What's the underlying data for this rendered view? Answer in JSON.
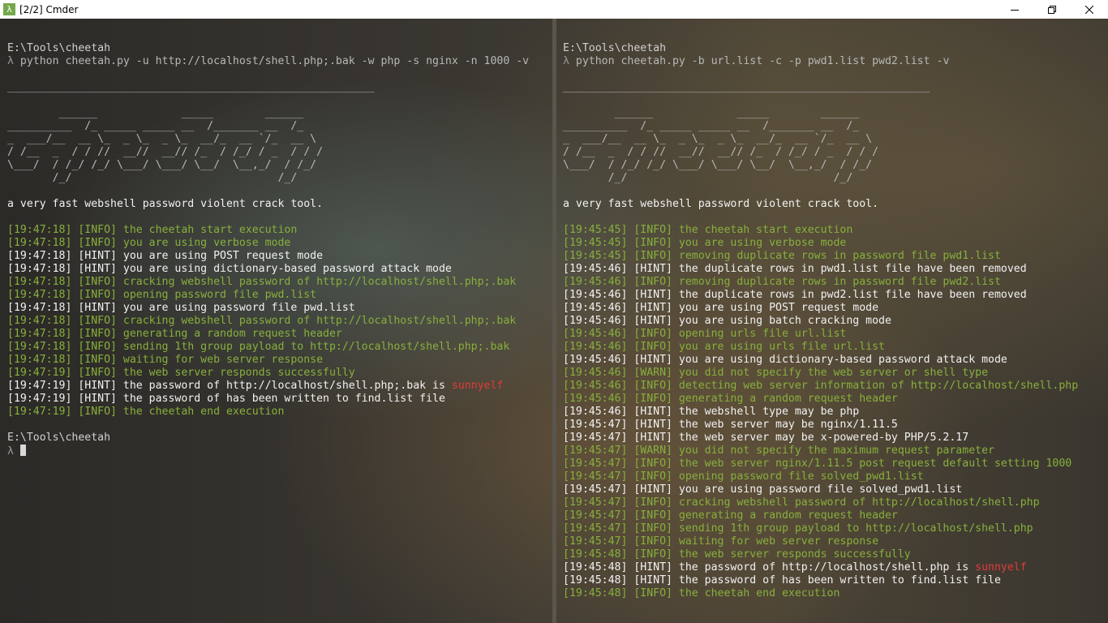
{
  "window": {
    "title": "[2/2] Cmder",
    "app_icon": "λ"
  },
  "colors": {
    "info": "#87b03c",
    "hint": "#f2f2f2",
    "password": "#e23a3a"
  },
  "left_pane": {
    "lines": [
      {
        "segs": [
          {
            "t": "E:\\Tools\\cheetah",
            "c": "prompt-path"
          }
        ]
      },
      {
        "segs": [
          {
            "t": "λ ",
            "c": "lambda"
          },
          {
            "t": "python cheetah.py -u http://localhost/shell.php;.bak -w php -s nginx -n 1000 -v",
            "c": "gray"
          }
        ]
      },
      {
        "segs": [
          {
            "t": "",
            "c": "gray"
          }
        ]
      },
      {
        "segs": [
          {
            "t": "_________________________________________________________",
            "c": "gray"
          }
        ]
      },
      {
        "segs": [
          {
            "t": "",
            "c": "gray"
          }
        ]
      },
      {
        "segs": [
          {
            "t": "        ______             _____        ______",
            "c": "gray"
          }
        ]
      },
      {
        "segs": [
          {
            "t": "__________  /_ _____ _____ __  /_______ __  /_",
            "c": "gray"
          }
        ]
      },
      {
        "segs": [
          {
            "t": "_  ___/__  __ \\_  _ \\_  _ \\_  __/_  __ `/_  __ \\",
            "c": "gray"
          }
        ]
      },
      {
        "segs": [
          {
            "t": "/ /__  _  / / //  __//  __// /_  / /_/ / _  / / /",
            "c": "gray"
          }
        ]
      },
      {
        "segs": [
          {
            "t": "\\___/  / /_/ /_/ \\___/ \\___/ \\__/  \\__,_/  / /_/",
            "c": "gray"
          }
        ]
      },
      {
        "segs": [
          {
            "t": "       /_/                                /_/",
            "c": "gray"
          }
        ]
      },
      {
        "segs": [
          {
            "t": "",
            "c": "gray"
          }
        ]
      },
      {
        "segs": [
          {
            "t": "a very fast webshell password violent crack tool.",
            "c": "white"
          }
        ]
      },
      {
        "segs": [
          {
            "t": "",
            "c": "gray"
          }
        ]
      },
      {
        "segs": [
          {
            "t": "[19:47:18] [INFO] the cheetah start execution",
            "c": "green"
          }
        ]
      },
      {
        "segs": [
          {
            "t": "[19:47:18] [INFO] you are using verbose mode",
            "c": "green"
          }
        ]
      },
      {
        "segs": [
          {
            "t": "[19:47:18] [HINT] you are using POST request mode",
            "c": "white"
          }
        ]
      },
      {
        "segs": [
          {
            "t": "[19:47:18] [HINT] you are using dictionary-based password attack mode",
            "c": "white"
          }
        ]
      },
      {
        "segs": [
          {
            "t": "[19:47:18] [INFO] cracking webshell password of http://localhost/shell.php;.bak",
            "c": "green"
          }
        ]
      },
      {
        "segs": [
          {
            "t": "[19:47:18] [INFO] opening password file pwd.list",
            "c": "green"
          }
        ]
      },
      {
        "segs": [
          {
            "t": "[19:47:18] [HINT] you are using password file pwd.list",
            "c": "white"
          }
        ]
      },
      {
        "segs": [
          {
            "t": "[19:47:18] [INFO] cracking webshell password of http://localhost/shell.php;.bak",
            "c": "green"
          }
        ]
      },
      {
        "segs": [
          {
            "t": "[19:47:18] [INFO] generating a random request header",
            "c": "green"
          }
        ]
      },
      {
        "segs": [
          {
            "t": "[19:47:18] [INFO] sending 1th group payload to http://localhost/shell.php;.bak",
            "c": "green"
          }
        ]
      },
      {
        "segs": [
          {
            "t": "[19:47:18] [INFO] waiting for web server response",
            "c": "green"
          }
        ]
      },
      {
        "segs": [
          {
            "t": "[19:47:19] [INFO] the web server responds successfully",
            "c": "green"
          }
        ]
      },
      {
        "segs": [
          {
            "t": "[19:47:19] [HINT] the password of http://localhost/shell.php;.bak is ",
            "c": "white"
          },
          {
            "t": "sunnyelf",
            "c": "red"
          }
        ]
      },
      {
        "segs": [
          {
            "t": "[19:47:19] [HINT] the password of has been written to find.list file",
            "c": "white"
          }
        ]
      },
      {
        "segs": [
          {
            "t": "[19:47:19] [INFO] the cheetah end execution",
            "c": "green"
          }
        ]
      },
      {
        "segs": [
          {
            "t": "",
            "c": "gray"
          }
        ]
      },
      {
        "segs": [
          {
            "t": "E:\\Tools\\cheetah",
            "c": "prompt-path"
          }
        ]
      },
      {
        "segs": [
          {
            "t": "λ ",
            "c": "lambda"
          }
        ],
        "cursor": true
      }
    ]
  },
  "right_pane": {
    "lines": [
      {
        "segs": [
          {
            "t": "E:\\Tools\\cheetah",
            "c": "prompt-path"
          }
        ]
      },
      {
        "segs": [
          {
            "t": "λ ",
            "c": "lambda"
          },
          {
            "t": "python cheetah.py -b url.list -c -p pwd1.list pwd2.list -v",
            "c": "gray"
          }
        ]
      },
      {
        "segs": [
          {
            "t": "",
            "c": "gray"
          }
        ]
      },
      {
        "segs": [
          {
            "t": "_________________________________________________________",
            "c": "gray"
          }
        ]
      },
      {
        "segs": [
          {
            "t": "",
            "c": "gray"
          }
        ]
      },
      {
        "segs": [
          {
            "t": "        ______             _____        ______",
            "c": "gray"
          }
        ]
      },
      {
        "segs": [
          {
            "t": "__________  /_ _____ _____ __  /_______ __  /_",
            "c": "gray"
          }
        ]
      },
      {
        "segs": [
          {
            "t": "_  ___/__  __ \\_  _ \\_  _ \\_  __/_  __ `/_  __ \\",
            "c": "gray"
          }
        ]
      },
      {
        "segs": [
          {
            "t": "/ /__  _  / / //  __//  __// /_  / /_/ / _  / / /",
            "c": "gray"
          }
        ]
      },
      {
        "segs": [
          {
            "t": "\\___/  / /_/ /_/ \\___/ \\___/ \\__/  \\__,_/  / /_/",
            "c": "gray"
          }
        ]
      },
      {
        "segs": [
          {
            "t": "       /_/                                /_/",
            "c": "gray"
          }
        ]
      },
      {
        "segs": [
          {
            "t": "",
            "c": "gray"
          }
        ]
      },
      {
        "segs": [
          {
            "t": "a very fast webshell password violent crack tool.",
            "c": "white"
          }
        ]
      },
      {
        "segs": [
          {
            "t": "",
            "c": "gray"
          }
        ]
      },
      {
        "segs": [
          {
            "t": "[19:45:45] [INFO] the cheetah start execution",
            "c": "green"
          }
        ]
      },
      {
        "segs": [
          {
            "t": "[19:45:45] [INFO] you are using verbose mode",
            "c": "green"
          }
        ]
      },
      {
        "segs": [
          {
            "t": "[19:45:45] [INFO] removing duplicate rows in password file pwd1.list",
            "c": "green"
          }
        ]
      },
      {
        "segs": [
          {
            "t": "[19:45:46] [HINT] the duplicate rows in pwd1.list file have been removed",
            "c": "white"
          }
        ]
      },
      {
        "segs": [
          {
            "t": "[19:45:46] [INFO] removing duplicate rows in password file pwd2.list",
            "c": "green"
          }
        ]
      },
      {
        "segs": [
          {
            "t": "[19:45:46] [HINT] the duplicate rows in pwd2.list file have been removed",
            "c": "white"
          }
        ]
      },
      {
        "segs": [
          {
            "t": "[19:45:46] [HINT] you are using POST request mode",
            "c": "white"
          }
        ]
      },
      {
        "segs": [
          {
            "t": "[19:45:46] [HINT] you are using batch cracking mode",
            "c": "white"
          }
        ]
      },
      {
        "segs": [
          {
            "t": "[19:45:46] [INFO] opening urls file url.list",
            "c": "green"
          }
        ]
      },
      {
        "segs": [
          {
            "t": "[19:45:46] [INFO] you are using urls file url.list",
            "c": "green"
          }
        ]
      },
      {
        "segs": [
          {
            "t": "[19:45:46] [HINT] you are using dictionary-based password attack mode",
            "c": "white"
          }
        ]
      },
      {
        "segs": [
          {
            "t": "[19:45:46] [WARN] you did not specify the web server or shell type",
            "c": "green"
          }
        ]
      },
      {
        "segs": [
          {
            "t": "[19:45:46] [INFO] detecting web server information of http://localhost/shell.php",
            "c": "green"
          }
        ]
      },
      {
        "segs": [
          {
            "t": "[19:45:46] [INFO] generating a random request header",
            "c": "green"
          }
        ]
      },
      {
        "segs": [
          {
            "t": "[19:45:46] [HINT] the webshell type may be php",
            "c": "white"
          }
        ]
      },
      {
        "segs": [
          {
            "t": "[19:45:47] [HINT] the web server may be nginx/1.11.5",
            "c": "white"
          }
        ]
      },
      {
        "segs": [
          {
            "t": "[19:45:47] [HINT] the web server may be x-powered-by PHP/5.2.17",
            "c": "white"
          }
        ]
      },
      {
        "segs": [
          {
            "t": "[19:45:47] [WARN] you did not specify the maximum request parameter",
            "c": "green"
          }
        ]
      },
      {
        "segs": [
          {
            "t": "[19:45:47] [INFO] the web server nginx/1.11.5 post request default setting 1000",
            "c": "green"
          }
        ]
      },
      {
        "segs": [
          {
            "t": "[19:45:47] [INFO] opening password file solved_pwd1.list",
            "c": "green"
          }
        ]
      },
      {
        "segs": [
          {
            "t": "[19:45:47] [HINT] you are using password file solved_pwd1.list",
            "c": "white"
          }
        ]
      },
      {
        "segs": [
          {
            "t": "[19:45:47] [INFO] cracking webshell password of http://localhost/shell.php",
            "c": "green"
          }
        ]
      },
      {
        "segs": [
          {
            "t": "[19:45:47] [INFO] generating a random request header",
            "c": "green"
          }
        ]
      },
      {
        "segs": [
          {
            "t": "[19:45:47] [INFO] sending 1th group payload to http://localhost/shell.php",
            "c": "green"
          }
        ]
      },
      {
        "segs": [
          {
            "t": "[19:45:47] [INFO] waiting for web server response",
            "c": "green"
          }
        ]
      },
      {
        "segs": [
          {
            "t": "[19:45:48] [INFO] the web server responds successfully",
            "c": "green"
          }
        ]
      },
      {
        "segs": [
          {
            "t": "[19:45:48] [HINT] the password of http://localhost/shell.php is ",
            "c": "white"
          },
          {
            "t": "sunnyelf",
            "c": "red"
          }
        ]
      },
      {
        "segs": [
          {
            "t": "[19:45:48] [HINT] the password of has been written to find.list file",
            "c": "white"
          }
        ]
      },
      {
        "segs": [
          {
            "t": "[19:45:48] [INFO] the cheetah end execution",
            "c": "green"
          }
        ]
      }
    ]
  }
}
